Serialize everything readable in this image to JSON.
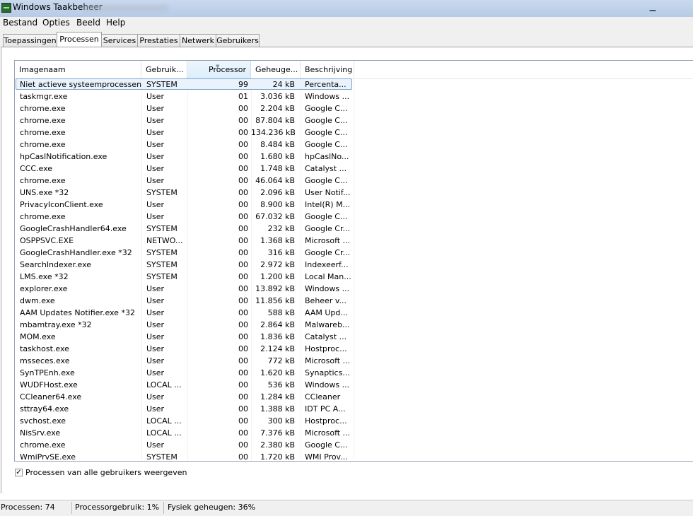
{
  "window": {
    "title": "Windows Taakbeheer"
  },
  "menu": [
    "Bestand",
    "Opties",
    "Beeld",
    "Help"
  ],
  "tabs": [
    {
      "label": "Toepassingen",
      "active": false
    },
    {
      "label": "Processen",
      "active": true
    },
    {
      "label": "Services",
      "active": false
    },
    {
      "label": "Prestaties",
      "active": false
    },
    {
      "label": "Netwerk",
      "active": false
    },
    {
      "label": "Gebruikers",
      "active": false
    }
  ],
  "columns": {
    "name": "Imagenaam",
    "user": "Gebruik...",
    "cpu": "Processor",
    "mem": "Geheuge...",
    "desc": "Beschrijving"
  },
  "processes": [
    {
      "name": "Niet actieve systeemprocessen",
      "user": "SYSTEM",
      "cpu": "99",
      "mem": "24 kB",
      "desc": "Percenta..."
    },
    {
      "name": "taskmgr.exe",
      "user": "User",
      "cpu": "01",
      "mem": "3.036 kB",
      "desc": "Windows ..."
    },
    {
      "name": "chrome.exe",
      "user": "User",
      "cpu": "00",
      "mem": "2.204 kB",
      "desc": "Google C..."
    },
    {
      "name": "chrome.exe",
      "user": "User",
      "cpu": "00",
      "mem": "87.804 kB",
      "desc": "Google C..."
    },
    {
      "name": "chrome.exe",
      "user": "User",
      "cpu": "00",
      "mem": "134.236 kB",
      "desc": "Google C..."
    },
    {
      "name": "chrome.exe",
      "user": "User",
      "cpu": "00",
      "mem": "8.484 kB",
      "desc": "Google C..."
    },
    {
      "name": "hpCaslNotification.exe",
      "user": "User",
      "cpu": "00",
      "mem": "1.680 kB",
      "desc": "hpCaslNo..."
    },
    {
      "name": "CCC.exe",
      "user": "User",
      "cpu": "00",
      "mem": "1.748 kB",
      "desc": "Catalyst ..."
    },
    {
      "name": "chrome.exe",
      "user": "User",
      "cpu": "00",
      "mem": "46.064 kB",
      "desc": "Google C..."
    },
    {
      "name": "UNS.exe *32",
      "user": "SYSTEM",
      "cpu": "00",
      "mem": "2.096 kB",
      "desc": "User Notif..."
    },
    {
      "name": "PrivacyIconClient.exe",
      "user": "User",
      "cpu": "00",
      "mem": "8.900 kB",
      "desc": "Intel(R) M..."
    },
    {
      "name": "chrome.exe",
      "user": "User",
      "cpu": "00",
      "mem": "67.032 kB",
      "desc": "Google C..."
    },
    {
      "name": "GoogleCrashHandler64.exe",
      "user": "SYSTEM",
      "cpu": "00",
      "mem": "232 kB",
      "desc": "Google Cr..."
    },
    {
      "name": "OSPPSVC.EXE",
      "user": "NETWO...",
      "cpu": "00",
      "mem": "1.368 kB",
      "desc": "Microsoft ..."
    },
    {
      "name": "GoogleCrashHandler.exe *32",
      "user": "SYSTEM",
      "cpu": "00",
      "mem": "316 kB",
      "desc": "Google Cr..."
    },
    {
      "name": "SearchIndexer.exe",
      "user": "SYSTEM",
      "cpu": "00",
      "mem": "2.972 kB",
      "desc": "Indexeerf..."
    },
    {
      "name": "LMS.exe *32",
      "user": "SYSTEM",
      "cpu": "00",
      "mem": "1.200 kB",
      "desc": "Local Man..."
    },
    {
      "name": "explorer.exe",
      "user": "User",
      "cpu": "00",
      "mem": "13.892 kB",
      "desc": "Windows ..."
    },
    {
      "name": "dwm.exe",
      "user": "User",
      "cpu": "00",
      "mem": "11.856 kB",
      "desc": "Beheer v..."
    },
    {
      "name": "AAM Updates Notifier.exe *32",
      "user": "User",
      "cpu": "00",
      "mem": "588 kB",
      "desc": "AAM Upd..."
    },
    {
      "name": "mbamtray.exe *32",
      "user": "User",
      "cpu": "00",
      "mem": "2.864 kB",
      "desc": "Malwareb..."
    },
    {
      "name": "MOM.exe",
      "user": "User",
      "cpu": "00",
      "mem": "1.836 kB",
      "desc": "Catalyst ..."
    },
    {
      "name": "taskhost.exe",
      "user": "User",
      "cpu": "00",
      "mem": "2.124 kB",
      "desc": "Hostproc..."
    },
    {
      "name": "msseces.exe",
      "user": "User",
      "cpu": "00",
      "mem": "772 kB",
      "desc": "Microsoft ..."
    },
    {
      "name": "SynTPEnh.exe",
      "user": "User",
      "cpu": "00",
      "mem": "1.620 kB",
      "desc": "Synaptics..."
    },
    {
      "name": "WUDFHost.exe",
      "user": "LOCAL ...",
      "cpu": "00",
      "mem": "536 kB",
      "desc": "Windows ..."
    },
    {
      "name": "CCleaner64.exe",
      "user": "User",
      "cpu": "00",
      "mem": "1.284 kB",
      "desc": "CCleaner"
    },
    {
      "name": "sttray64.exe",
      "user": "User",
      "cpu": "00",
      "mem": "1.388 kB",
      "desc": "IDT PC A..."
    },
    {
      "name": "svchost.exe",
      "user": "LOCAL ...",
      "cpu": "00",
      "mem": "300 kB",
      "desc": "Hostproc..."
    },
    {
      "name": "NisSrv.exe",
      "user": "LOCAL ...",
      "cpu": "00",
      "mem": "7.376 kB",
      "desc": "Microsoft ..."
    },
    {
      "name": "chrome.exe",
      "user": "User",
      "cpu": "00",
      "mem": "2.380 kB",
      "desc": "Google C..."
    },
    {
      "name": "WmiPrvSE.exe",
      "user": "SYSTEM",
      "cpu": "00",
      "mem": "1.720 kB",
      "desc": "WMI Prov..."
    }
  ],
  "show_all_checkbox": {
    "label": "Processen van alle gebruikers weergeven",
    "checked": true
  },
  "status": {
    "processes": "Processen: 74",
    "cpu_usage": "Processorgebruik: 1%",
    "memory": "Fysiek geheugen: 36%"
  }
}
